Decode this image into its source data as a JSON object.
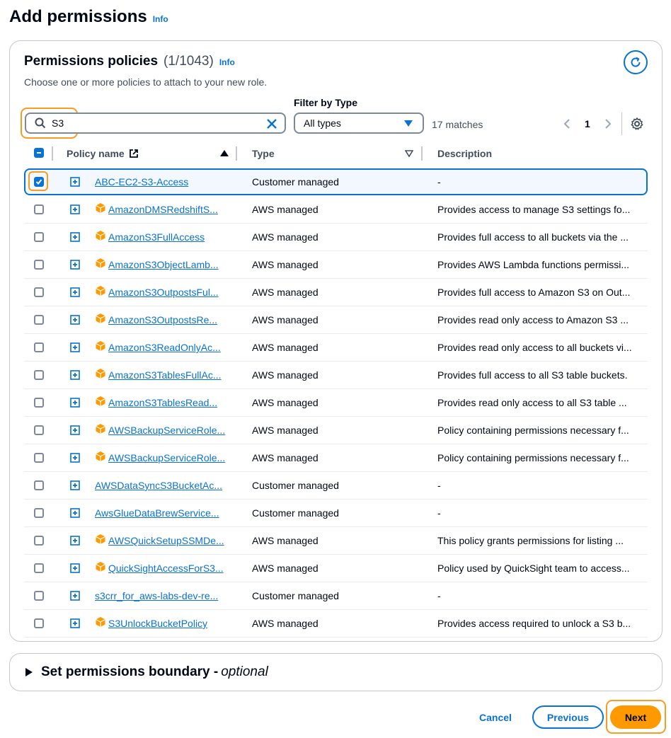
{
  "page": {
    "title": "Add permissions",
    "info": "Info"
  },
  "policies": {
    "title": "Permissions policies",
    "count": "(1/1043)",
    "info": "Info",
    "description": "Choose one or more policies to attach to your new role.",
    "search_value": "S3",
    "filter_label": "Filter by Type",
    "filter_value": "All types",
    "matches": "17 matches",
    "page_number": "1",
    "columns": {
      "name": "Policy name",
      "type": "Type",
      "description": "Description"
    },
    "rows": [
      {
        "name": "ABC-EC2-S3-Access",
        "type": "Customer managed",
        "description": "-",
        "checked": true,
        "aws_icon": false
      },
      {
        "name": "AmazonDMSRedshiftS...",
        "type": "AWS managed",
        "description": "Provides access to manage S3 settings fo...",
        "checked": false,
        "aws_icon": true
      },
      {
        "name": "AmazonS3FullAccess",
        "type": "AWS managed",
        "description": "Provides full access to all buckets via the ...",
        "checked": false,
        "aws_icon": true
      },
      {
        "name": "AmazonS3ObjectLamb...",
        "type": "AWS managed",
        "description": "Provides AWS Lambda functions permissi...",
        "checked": false,
        "aws_icon": true
      },
      {
        "name": "AmazonS3OutpostsFul...",
        "type": "AWS managed",
        "description": "Provides full access to Amazon S3 on Out...",
        "checked": false,
        "aws_icon": true
      },
      {
        "name": "AmazonS3OutpostsRe...",
        "type": "AWS managed",
        "description": "Provides read only access to Amazon S3 ...",
        "checked": false,
        "aws_icon": true
      },
      {
        "name": "AmazonS3ReadOnlyAc...",
        "type": "AWS managed",
        "description": "Provides read only access to all buckets vi...",
        "checked": false,
        "aws_icon": true
      },
      {
        "name": "AmazonS3TablesFullAc...",
        "type": "AWS managed",
        "description": "Provides full access to all S3 table buckets.",
        "checked": false,
        "aws_icon": true
      },
      {
        "name": "AmazonS3TablesRead...",
        "type": "AWS managed",
        "description": "Provides read only access to all S3 table ...",
        "checked": false,
        "aws_icon": true
      },
      {
        "name": "AWSBackupServiceRole...",
        "type": "AWS managed",
        "description": "Policy containing permissions necessary f...",
        "checked": false,
        "aws_icon": true
      },
      {
        "name": "AWSBackupServiceRole...",
        "type": "AWS managed",
        "description": "Policy containing permissions necessary f...",
        "checked": false,
        "aws_icon": true
      },
      {
        "name": "AWSDataSyncS3BucketAc...",
        "type": "Customer managed",
        "description": "-",
        "checked": false,
        "aws_icon": false
      },
      {
        "name": "AwsGlueDataBrewService...",
        "type": "Customer managed",
        "description": "-",
        "checked": false,
        "aws_icon": false
      },
      {
        "name": "AWSQuickSetupSSMDe...",
        "type": "AWS managed",
        "description": "This policy grants permissions for listing ...",
        "checked": false,
        "aws_icon": true
      },
      {
        "name": "QuickSightAccessForS3...",
        "type": "AWS managed",
        "description": "Policy used by QuickSight team to access...",
        "checked": false,
        "aws_icon": true
      },
      {
        "name": "s3crr_for_aws-labs-dev-re...",
        "type": "Customer managed",
        "description": "-",
        "checked": false,
        "aws_icon": false
      },
      {
        "name": "S3UnlockBucketPolicy",
        "type": "AWS managed",
        "description": "Provides access required to unlock a S3 b...",
        "checked": false,
        "aws_icon": true
      }
    ]
  },
  "boundary": {
    "title": "Set permissions boundary - ",
    "optional": "optional"
  },
  "footer": {
    "cancel": "Cancel",
    "previous": "Previous",
    "next": "Next"
  },
  "colors": {
    "primary": "#0972d3",
    "accent": "#ff9900",
    "highlight": "#f89c24"
  }
}
